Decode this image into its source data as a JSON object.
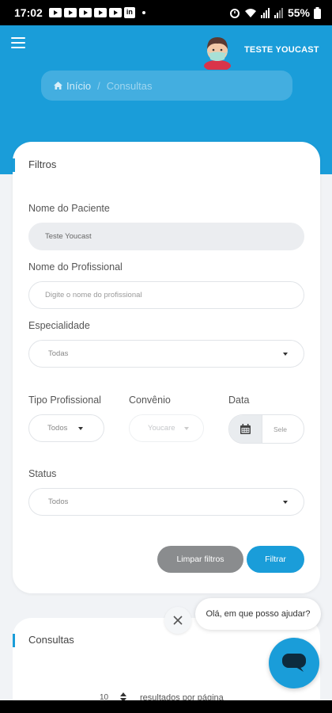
{
  "status_bar": {
    "time": "17:02",
    "battery": "55%"
  },
  "header": {
    "user_name": "TESTE YOUCAST"
  },
  "breadcrumb": {
    "home": "Início",
    "current": "Consultas"
  },
  "filters": {
    "title": "Filtros",
    "patient_label": "Nome do Paciente",
    "patient_value": "Teste Youcast",
    "professional_label": "Nome do Profissional",
    "professional_placeholder": "Digite o nome do profissional",
    "specialty_label": "Especialidade",
    "specialty_value": "Todas",
    "type_label": "Tipo Profissional",
    "type_value": "Todos",
    "insurance_label": "Convênio",
    "insurance_value": "Youcare",
    "date_label": "Data",
    "date_placeholder": "Sele",
    "status_label": "Status",
    "status_value": "Todos",
    "clear_button": "Limpar filtros",
    "filter_button": "Filtrar"
  },
  "consultas": {
    "title": "Consultas",
    "page_size": "10",
    "page_size_label": "resultados por página"
  },
  "chat": {
    "message": "Olá, em que posso ajudar?"
  },
  "colors": {
    "primary": "#1a9dd9",
    "background": "#f1f3f6",
    "clear_button": "#8a8c8e"
  }
}
